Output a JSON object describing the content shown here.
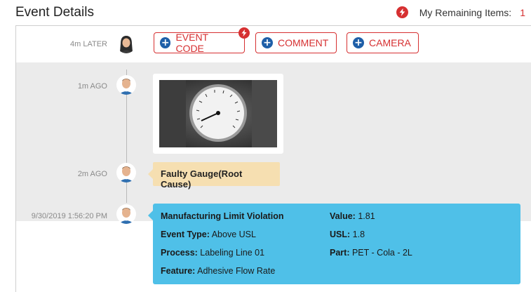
{
  "header": {
    "title": "Event Details",
    "remaining_label": "My Remaining Items:",
    "remaining_count": "1"
  },
  "actions_row": {
    "time": "4m LATER",
    "buttons": [
      {
        "label": "EVENT CODE",
        "icon": "plus-circle-icon",
        "flash": true
      },
      {
        "label": "COMMENT",
        "icon": "plus-circle-icon"
      },
      {
        "label": "CAMERA",
        "icon": "plus-circle-icon"
      }
    ]
  },
  "timeline": [
    {
      "time": "1m AGO",
      "type": "photo",
      "photo_subject": "pressure-gauge"
    },
    {
      "time": "2m AGO",
      "type": "note",
      "text": "Faulty Gauge(Root Cause)"
    }
  ],
  "event": {
    "time": "9/30/2019 1:56:20 PM",
    "title": "Manufacturing Limit Violation",
    "fields": {
      "event_type_label": "Event Type:",
      "event_type": "Above USL",
      "process_label": "Process:",
      "process": "Labeling Line 01",
      "feature_label": "Feature:",
      "feature": "Adhesive Flow Rate",
      "value_label": "Value:",
      "value": "1.81",
      "usl_label": "USL:",
      "usl": "1.8",
      "part_label": "Part:",
      "part": "PET - Cola - 2L"
    }
  },
  "colors": {
    "accent_red": "#d63031",
    "button_icon_blue": "#1e5fa8",
    "note_bg": "#f6dfb1",
    "event_bg": "#4fc0e8"
  }
}
